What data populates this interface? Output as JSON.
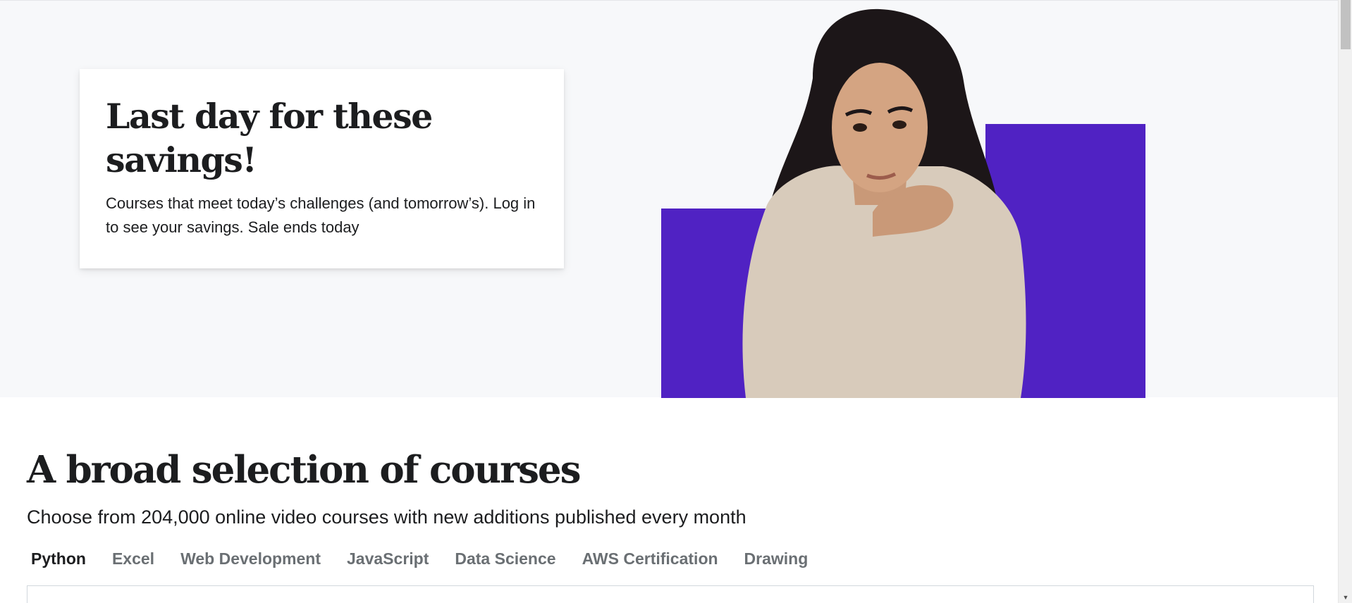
{
  "hero": {
    "title": "Last day for these savings!",
    "subtitle": "Courses that meet today’s challenges (and tomorrow’s). Log in to see your savings. Sale ends today",
    "accent_color": "#5022c3"
  },
  "section": {
    "title": "A broad selection of courses",
    "subtitle": "Choose from 204,000 online video courses with new additions published every month"
  },
  "tabs": [
    {
      "label": "Python",
      "active": true
    },
    {
      "label": "Excel",
      "active": false
    },
    {
      "label": "Web Development",
      "active": false
    },
    {
      "label": "JavaScript",
      "active": false
    },
    {
      "label": "Data Science",
      "active": false
    },
    {
      "label": "AWS Certification",
      "active": false
    },
    {
      "label": "Drawing",
      "active": false
    }
  ],
  "icons": {
    "scroll_down": "chevron-down-icon"
  }
}
